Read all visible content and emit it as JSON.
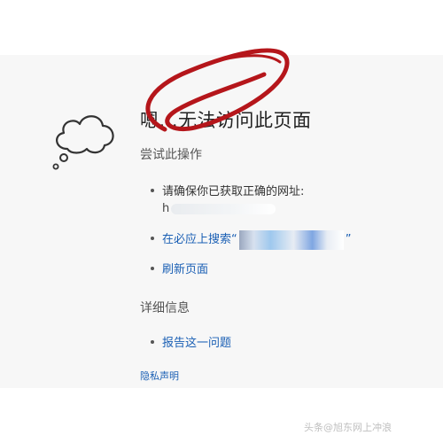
{
  "title": "嗯...无法访问此页面",
  "try_section": {
    "heading": "尝试此操作",
    "url_item": {
      "label": "请确保你已获取正确的网址:",
      "url_prefix": "h"
    },
    "search_item": {
      "prefix": "在必应上搜索“",
      "suffix": "”"
    },
    "refresh_item": {
      "label": "刷新页面"
    }
  },
  "details_section": {
    "heading": "详细信息",
    "report_item": {
      "label": "报告这一问题"
    }
  },
  "privacy_link": "隐私声明",
  "watermark": "头条@旭东网上冲浪",
  "colors": {
    "link": "#1a5fb4",
    "annotation": "#b5161b",
    "page_bg": "#f7f7f7"
  },
  "icons": {
    "cloud": "thought-cloud-icon",
    "annotation": "red-circle-annotation"
  }
}
